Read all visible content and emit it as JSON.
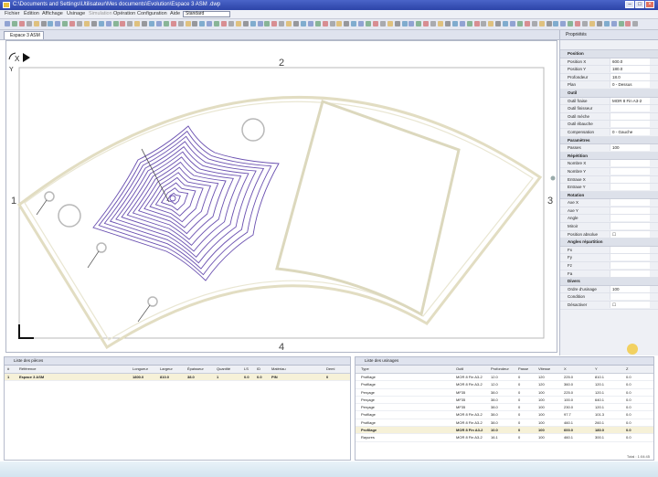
{
  "window": {
    "title": "C:\\Documents and Settings\\Utilisateur\\Mes documents\\Evolution\\Espace 3 ASM .dwp",
    "minimize_label": "–",
    "maximize_label": "□",
    "close_label": "×"
  },
  "menu": {
    "items": [
      "Fichier",
      "Édition",
      "Affichage",
      "Usinage",
      "Simulation",
      "Opération",
      "Configuration",
      "Aide"
    ],
    "profile_value": "Standard"
  },
  "document_tab": {
    "label": "Espace 3 ASM"
  },
  "canvas": {
    "axis_x_label": "X",
    "axis_y_label": "Y",
    "side_labels": {
      "top": "2",
      "left": "1",
      "right": "3",
      "bottom": "4"
    }
  },
  "properties": {
    "title": "Propriétés",
    "sections": [
      {
        "name": "Position",
        "rows": [
          {
            "key": "Position X",
            "value": "600.0"
          },
          {
            "key": "Position Y",
            "value": "180.0"
          },
          {
            "key": "Profondeur",
            "value": "18.0"
          },
          {
            "key": "Plan",
            "value": "0 - Dessus"
          }
        ]
      },
      {
        "name": "Outil",
        "rows": [
          {
            "key": "Outil fraise",
            "value": "MOR 8 Fin A3-2"
          },
          {
            "key": "Outil finisseur",
            "value": ""
          },
          {
            "key": "Outil mèche",
            "value": ""
          },
          {
            "key": "Outil ébauche",
            "value": ""
          },
          {
            "key": "Compensation",
            "value": "0 - Gauche"
          }
        ]
      },
      {
        "name": "Paramètres",
        "rows": [
          {
            "key": "Passes",
            "value": "100"
          }
        ]
      },
      {
        "name": "Répétition",
        "rows": [
          {
            "key": "Nombre X",
            "value": ""
          },
          {
            "key": "Nombre Y",
            "value": ""
          },
          {
            "key": "Entraxe X",
            "value": ""
          },
          {
            "key": "Entraxe Y",
            "value": ""
          }
        ]
      },
      {
        "name": "Rotation",
        "rows": [
          {
            "key": "Axe X",
            "value": ""
          },
          {
            "key": "Axe Y",
            "value": ""
          },
          {
            "key": "Angle",
            "value": ""
          },
          {
            "key": "Miroir",
            "value": ""
          },
          {
            "key": "Position absolue",
            "value": "☐"
          }
        ]
      },
      {
        "name": "Angles répartition",
        "rows": [
          {
            "key": "Fx",
            "value": ""
          },
          {
            "key": "Fy",
            "value": ""
          },
          {
            "key": "Fz",
            "value": ""
          },
          {
            "key": "Fa",
            "value": ""
          }
        ]
      },
      {
        "name": "Divers",
        "rows": [
          {
            "key": "Ordre d'usinage",
            "value": "100"
          },
          {
            "key": "Condition",
            "value": ""
          },
          {
            "key": "Désactiver",
            "value": "☐"
          }
        ]
      }
    ]
  },
  "pieces_panel": {
    "title": "Liste des pièces",
    "columns": [
      "#",
      "Référence",
      "Longueur",
      "Largeur",
      "Épaisseur",
      "Quantité",
      "LS",
      "ID",
      "Matériau",
      "Demi"
    ],
    "rows": [
      {
        "cells": [
          "1",
          "Espace 3 ASM",
          "1800.0",
          "810.0",
          "38.0",
          "1",
          "0.0",
          "0.0",
          "PIN",
          "0"
        ],
        "selected": true
      }
    ]
  },
  "operations_panel": {
    "title": "Liste des usinages",
    "columns": [
      "Type",
      "Outil",
      "Profondeur",
      "Passe",
      "Vitesse",
      "X",
      "Y",
      "Z"
    ],
    "rows": [
      {
        "cells": [
          "Profilage",
          "MOR 8 Fin A3-2",
          "12.0",
          "0",
          "120",
          "225.0",
          "810.1",
          "0.0"
        ],
        "selected": false
      },
      {
        "cells": [
          "Profilage",
          "MOR 8 Fin A3-2",
          "12.0",
          "0",
          "120",
          "360.0",
          "120.1",
          "0.0"
        ],
        "selected": false
      },
      {
        "cells": [
          "Perçage",
          "MF35",
          "38.0",
          "0",
          "100",
          "225.0",
          "120.1",
          "0.0"
        ],
        "selected": false
      },
      {
        "cells": [
          "Perçage",
          "MF35",
          "38.0",
          "0",
          "100",
          "100.0",
          "640.1",
          "0.0"
        ],
        "selected": false
      },
      {
        "cells": [
          "Perçage",
          "MF35",
          "38.0",
          "0",
          "100",
          "230.0",
          "120.1",
          "0.0"
        ],
        "selected": false
      },
      {
        "cells": [
          "Profilage",
          "MOR 8 Fin A3-2",
          "38.0",
          "0",
          "100",
          "97.7",
          "101.3",
          "0.0"
        ],
        "selected": false
      },
      {
        "cells": [
          "Profilage",
          "MOR 8 Fin A3-2",
          "38.0",
          "0",
          "100",
          "460.1",
          "260.1",
          "0.0"
        ],
        "selected": false
      },
      {
        "cells": [
          "Profilage",
          "MOR 8 Fin A3-2",
          "10.0",
          "0",
          "100",
          "600.0",
          "180.0",
          "0.0"
        ],
        "selected": true
      },
      {
        "cells": [
          "Rayures",
          "MOR 8 Fin A3-2",
          "16.1",
          "0",
          "100",
          "460.1",
          "300.1",
          "0.0"
        ],
        "selected": false
      }
    ],
    "footer": "Total : 1:04:45"
  },
  "colors": {
    "titlebar": "#2c44a8",
    "part_outline": "#e0dcc0",
    "pocket_toolpath": "#6a50b0",
    "panel_header": "#dfe3ee"
  }
}
